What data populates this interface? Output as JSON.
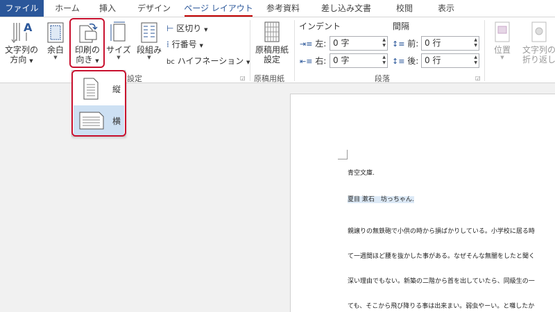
{
  "tabs": {
    "file": "ファイル",
    "home": "ホーム",
    "insert": "挿入",
    "design": "デザイン",
    "page_layout": "ページ レイアウト",
    "references": "参考資料",
    "mailings": "差し込み文書",
    "review": "校閲",
    "view": "表示"
  },
  "ribbon": {
    "text_direction": [
      "文字列の",
      "方向"
    ],
    "margins": "余白",
    "orientation": [
      "印刷の",
      "向き"
    ],
    "size": "サイズ",
    "columns": "段組み",
    "breaks": "区切り",
    "line_numbers": "行番号",
    "hyphenation": "ハイフネーション",
    "page_setup_group_fragment": "設定",
    "manuscript": [
      "原稿用紙",
      "設定"
    ],
    "manuscript_group": "原稿用紙",
    "indent_title": "インデント",
    "indent_left_label": "左:",
    "indent_left_value": "0 字",
    "indent_right_label": "右:",
    "indent_right_value": "0 字",
    "spacing_title": "間隔",
    "spacing_before_label": "前:",
    "spacing_before_value": "0 行",
    "spacing_after_label": "後:",
    "spacing_after_value": "0 行",
    "paragraph_group": "段落",
    "position": "位置",
    "wrap_text": [
      "文字列の",
      "折り返し"
    ]
  },
  "orientation_menu": {
    "portrait": "縦",
    "landscape": "横"
  },
  "document": {
    "lines": [
      "青空文庫.",
      "夏目 漱石　坊っちゃん.",
      "親譲りの無鉄砲で小供の時から損ばかりしている。小学校に居る時",
      "て一週間ほど腰を抜かした事がある。なぜそんな無闇をしたと聞く",
      "深い理由でもない。新築の二階から首を出していたら、同級生の一",
      "ても、そこから飛び降りる事は出来まい。弱虫やーい。と囃したか"
    ]
  },
  "colors": {
    "file_tab_bg": "#2b579a",
    "active_tab_text": "#2b579a",
    "highlight_red": "#c8102e",
    "selected_item_bg": "#cde0f3"
  }
}
